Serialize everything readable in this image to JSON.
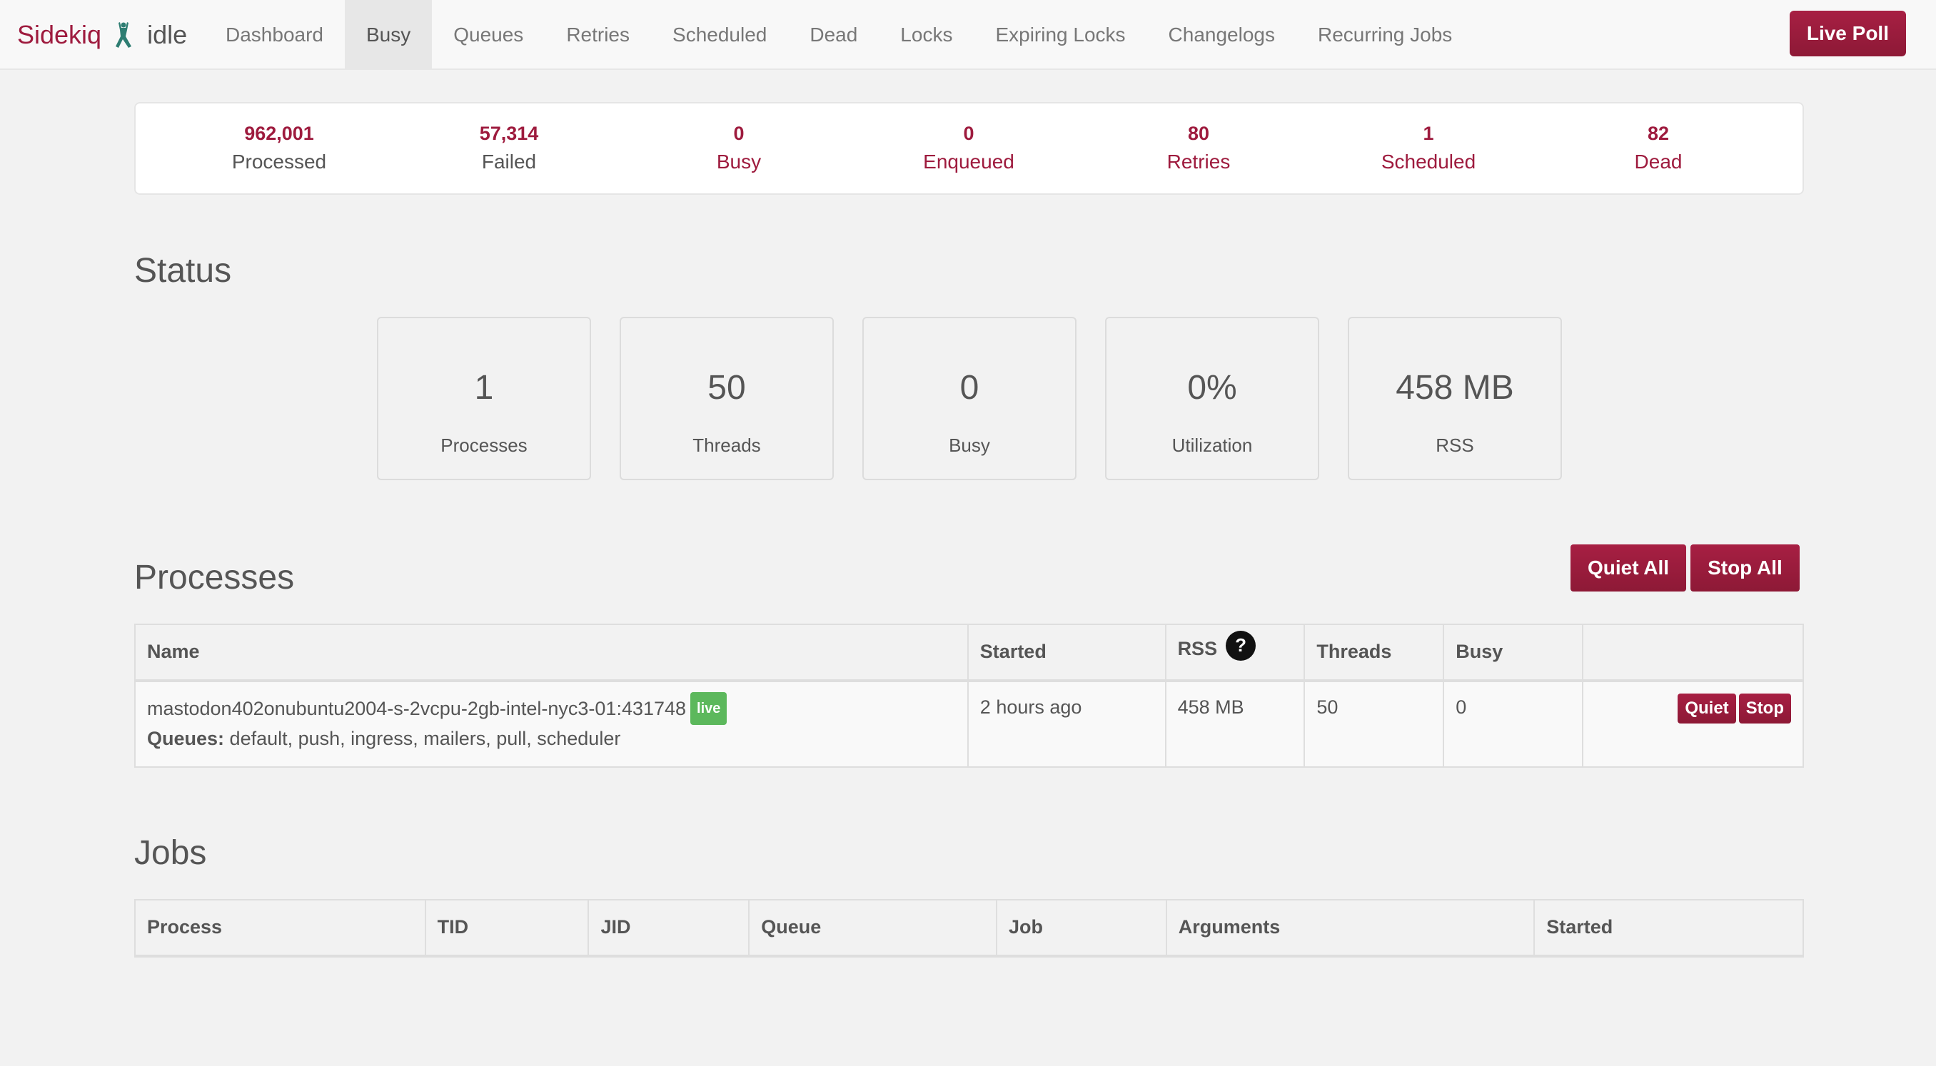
{
  "navbar": {
    "brand": "Sidekiq",
    "status": "idle",
    "items": [
      {
        "label": "Dashboard",
        "active": false
      },
      {
        "label": "Busy",
        "active": true
      },
      {
        "label": "Queues",
        "active": false
      },
      {
        "label": "Retries",
        "active": false
      },
      {
        "label": "Scheduled",
        "active": false
      },
      {
        "label": "Dead",
        "active": false
      },
      {
        "label": "Locks",
        "active": false
      },
      {
        "label": "Expiring Locks",
        "active": false
      },
      {
        "label": "Changelogs",
        "active": false
      },
      {
        "label": "Recurring Jobs",
        "active": false
      }
    ],
    "live_poll_label": "Live Poll",
    "accent_color": "#9e1b3e"
  },
  "summary": [
    {
      "count": "962,001",
      "label": "Processed"
    },
    {
      "count": "57,314",
      "label": "Failed"
    },
    {
      "count": "0",
      "label": "Busy"
    },
    {
      "count": "0",
      "label": "Enqueued"
    },
    {
      "count": "80",
      "label": "Retries"
    },
    {
      "count": "1",
      "label": "Scheduled"
    },
    {
      "count": "82",
      "label": "Dead"
    }
  ],
  "status": {
    "title": "Status",
    "cards": [
      {
        "value": "1",
        "label": "Processes"
      },
      {
        "value": "50",
        "label": "Threads"
      },
      {
        "value": "0",
        "label": "Busy"
      },
      {
        "value": "0%",
        "label": "Utilization"
      },
      {
        "value": "458 MB",
        "label": "RSS"
      }
    ]
  },
  "processes": {
    "title": "Processes",
    "quiet_all_label": "Quiet All",
    "stop_all_label": "Stop All",
    "columns": [
      "Name",
      "Started",
      "RSS",
      "Threads",
      "Busy",
      ""
    ],
    "rss_help": "?",
    "rows": [
      {
        "name": "mastodon402onubuntu2004-s-2vcpu-2gb-intel-nyc3-01:431748",
        "badge": "live",
        "queues_label": "Queues:",
        "queues": "default, push, ingress, mailers, pull, scheduler",
        "started": "2 hours ago",
        "rss": "458 MB",
        "threads": "50",
        "busy": "0",
        "quiet_label": "Quiet",
        "stop_label": "Stop"
      }
    ]
  },
  "jobs": {
    "title": "Jobs",
    "columns": [
      "Process",
      "TID",
      "JID",
      "Queue",
      "Job",
      "Arguments",
      "Started"
    ]
  }
}
